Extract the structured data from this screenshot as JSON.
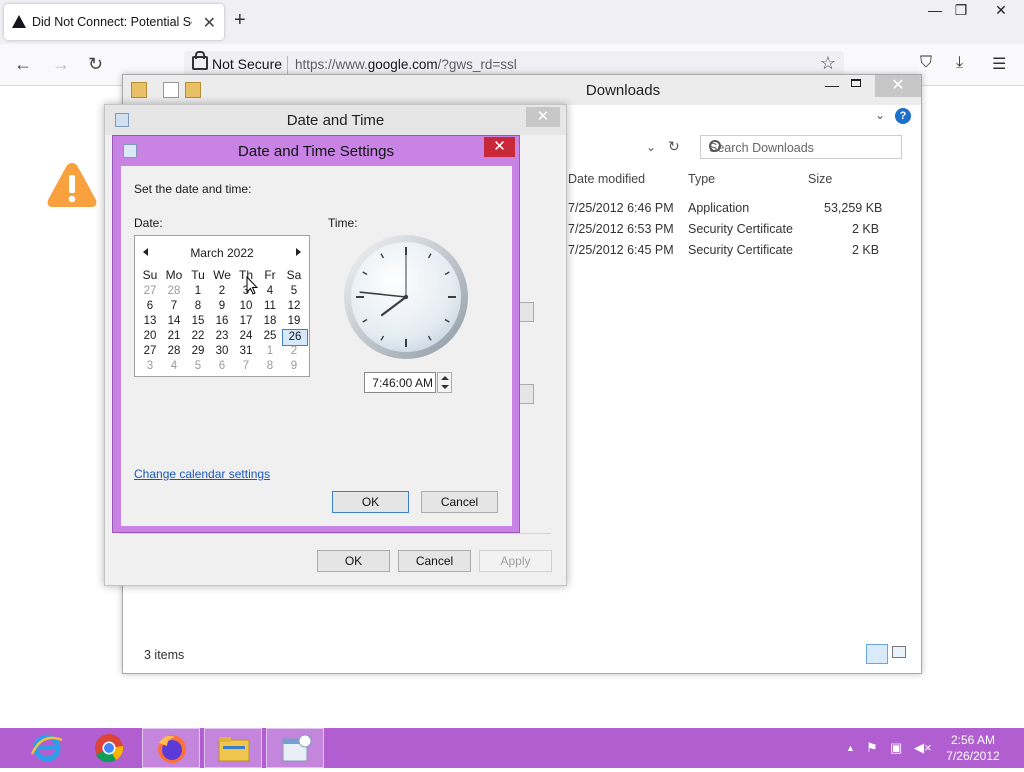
{
  "browser": {
    "tab_title": "Did Not Connect: Potential Security Issue",
    "tab_close": "✕",
    "new_tab": "+",
    "window_min": "—",
    "window_restore": "❐",
    "window_close": "✕",
    "nav_back": "←",
    "nav_forward": "→",
    "nav_reload": "↻",
    "not_secure_label": "Not Secure",
    "url_prefix": "https://www.",
    "url_domain": "google.com",
    "url_suffix": "/?gws_rd=ssl",
    "bookmark_star": "☆",
    "pocket_icon": "⛉",
    "downloads_icon": "⤓",
    "menu_icon": "☰"
  },
  "explorer": {
    "title": "Downloads",
    "close": "✕",
    "search_placeholder": "Search Downloads",
    "columns": [
      "Date modified",
      "Type",
      "Size"
    ],
    "rows": [
      {
        "date": "7/25/2012 6:46 PM",
        "type": "Application",
        "size": "53,259 KB"
      },
      {
        "date": "7/25/2012 6:53 PM",
        "type": "Security Certificate",
        "size": "2 KB"
      },
      {
        "date": "7/25/2012 6:45 PM",
        "type": "Security Certificate",
        "size": "2 KB"
      }
    ],
    "status": "3 items",
    "help": "?"
  },
  "date_time_dialog": {
    "title": "Date and Time",
    "close": "✕",
    "ok": "OK",
    "cancel": "Cancel",
    "apply": "Apply"
  },
  "settings_dialog": {
    "title": "Date and Time Settings",
    "close": "✕",
    "prompt": "Set the date and time:",
    "date_label": "Date:",
    "time_label": "Time:",
    "month_label": "March 2022",
    "weekdays": [
      "Su",
      "Mo",
      "Tu",
      "We",
      "Th",
      "Fr",
      "Sa"
    ],
    "weeks": [
      [
        "27",
        "28",
        "1",
        "2",
        "3",
        "4",
        "5"
      ],
      [
        "6",
        "7",
        "8",
        "9",
        "10",
        "11",
        "12"
      ],
      [
        "13",
        "14",
        "15",
        "16",
        "17",
        "18",
        "19"
      ],
      [
        "20",
        "21",
        "22",
        "23",
        "24",
        "25",
        "26"
      ],
      [
        "27",
        "28",
        "29",
        "30",
        "31",
        "1",
        "2"
      ],
      [
        "3",
        "4",
        "5",
        "6",
        "7",
        "8",
        "9"
      ]
    ],
    "selected_day": "26",
    "time_value": "7:46:00 AM",
    "clock": {
      "hour": 7,
      "minute": 46,
      "second": 0
    },
    "change_calendar_link": "Change calendar settings",
    "ok": "OK",
    "cancel": "Cancel"
  },
  "taskbar": {
    "clock_time": "2:56 AM",
    "clock_date": "7/26/2012",
    "tray_arrow": "▲",
    "apps": [
      "internet-explorer",
      "chrome",
      "firefox",
      "file-explorer",
      "date-time-settings"
    ]
  },
  "colors": {
    "taskbar": "#b05ed0",
    "dialog_frame": "#c983e5",
    "close_red": "#c7293b",
    "warning_orange": "#f9a03f"
  }
}
